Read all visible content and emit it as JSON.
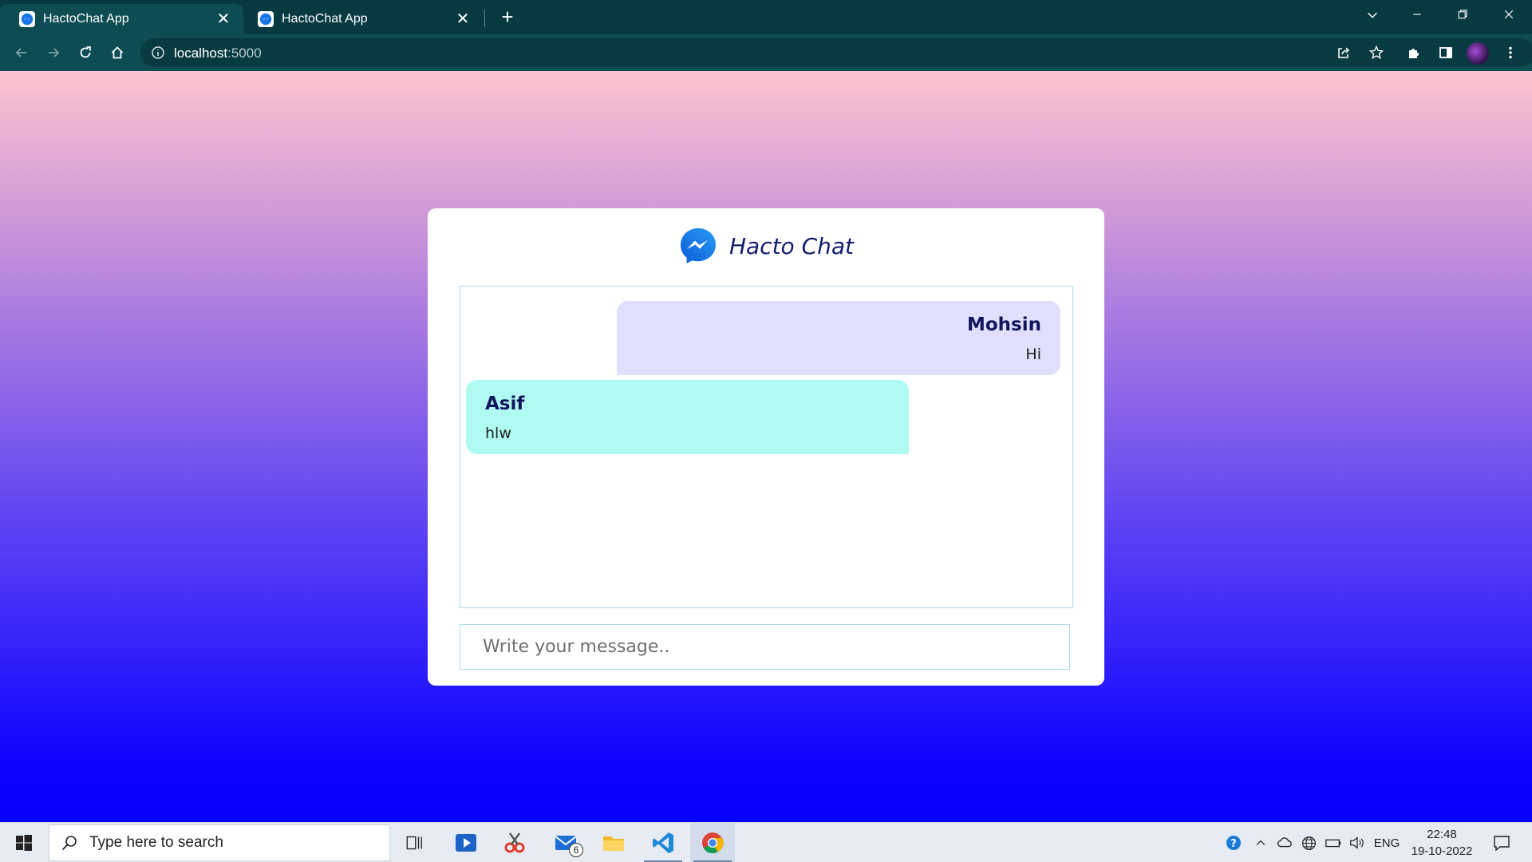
{
  "browser": {
    "tabs": [
      {
        "title": "HactoChat App",
        "close": "✕"
      },
      {
        "title": "HactoChat App",
        "close": "✕"
      }
    ],
    "new_tab": "+",
    "url_host": "localhost",
    "url_port": ":5000"
  },
  "app": {
    "brand": "Hacto Chat",
    "messages": [
      {
        "sender": "Mohsin",
        "text": "Hi",
        "side": "right"
      },
      {
        "sender": "Asif",
        "text": "hlw",
        "side": "left"
      }
    ],
    "input_placeholder": "Write your message.."
  },
  "taskbar": {
    "search_placeholder": "Type here to search",
    "mail_badge": "6",
    "language": "ENG",
    "time": "22:48",
    "date": "19-10-2022"
  },
  "colors": {
    "tabbar": "#063940",
    "toolbar": "#0d4c53",
    "brand_text": "#141d6e",
    "outgoing_bubble": "#e1e0fc",
    "incoming_bubble": "#affaf1",
    "border": "#a8dbea"
  }
}
